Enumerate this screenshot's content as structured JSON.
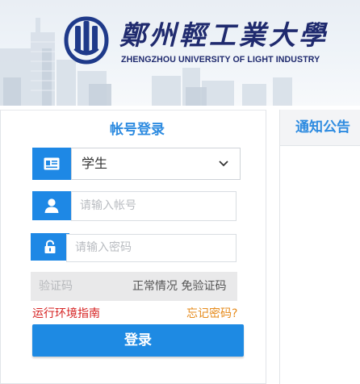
{
  "header": {
    "school_name_cn": "鄭州輕工業大學",
    "school_name_en": "ZHENGZHOU UNIVERSITY OF LIGHT INDUSTRY"
  },
  "login": {
    "title": "帐号登录",
    "role": {
      "selected": "学生",
      "icon": "id-card-icon"
    },
    "username": {
      "placeholder": "请输入帐号",
      "icon": "user-icon"
    },
    "password": {
      "placeholder": "请输入密码",
      "icon": "lock-icon"
    },
    "captcha": {
      "placeholder": "验证码",
      "status": "正常情况 免验证码"
    },
    "env_guide_link": "运行环境指南",
    "forgot_link": "忘记密码?",
    "submit_label": "登录"
  },
  "notice": {
    "title": "通知公告"
  },
  "colors": {
    "accent": "#1e88e5",
    "title_blue": "#2d8be0",
    "link_red": "#d62222",
    "link_orange": "#e68a1a",
    "brand_navy": "#1f2a6e"
  }
}
